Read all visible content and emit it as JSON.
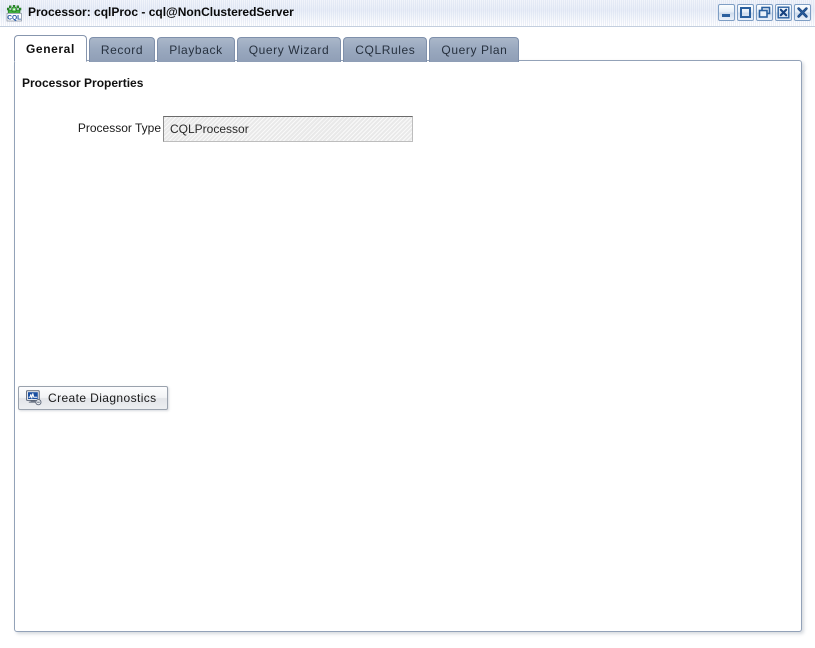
{
  "window": {
    "title": "Processor: cqlProc - cql@NonClusteredServer",
    "icon": "cql-gear-icon",
    "controls": [
      {
        "name": "minimize-button",
        "glyph": "minimize"
      },
      {
        "name": "maximize-button",
        "glyph": "maximize"
      },
      {
        "name": "restore-button",
        "glyph": "restore"
      },
      {
        "name": "close-view-button",
        "glyph": "close-boxed"
      },
      {
        "name": "close-button",
        "glyph": "close"
      }
    ]
  },
  "tabs": [
    {
      "label": "General",
      "active": true
    },
    {
      "label": "Record",
      "active": false
    },
    {
      "label": "Playback",
      "active": false
    },
    {
      "label": "Query Wizard",
      "active": false
    },
    {
      "label": "CQLRules",
      "active": false
    },
    {
      "label": "Query Plan",
      "active": false
    }
  ],
  "content": {
    "section_title": "Processor Properties",
    "fields": [
      {
        "label": "Processor Type",
        "value": "CQLProcessor",
        "placeholder": ""
      }
    ],
    "diagnostics_button": {
      "label": "Create Diagnostics",
      "icon": "diagnostics-monitor-icon"
    }
  },
  "colors": {
    "titlebar_top": "#f2f5fb",
    "titlebar_bottom": "#ffffff",
    "tab_inactive": "#9aa9bf",
    "tab_active": "#ffffff",
    "panel_border": "#93a2b8",
    "field_background": "#e9e9e9",
    "icon_accent": "#1a4fa0",
    "icon_green": "#2f9e2f"
  }
}
